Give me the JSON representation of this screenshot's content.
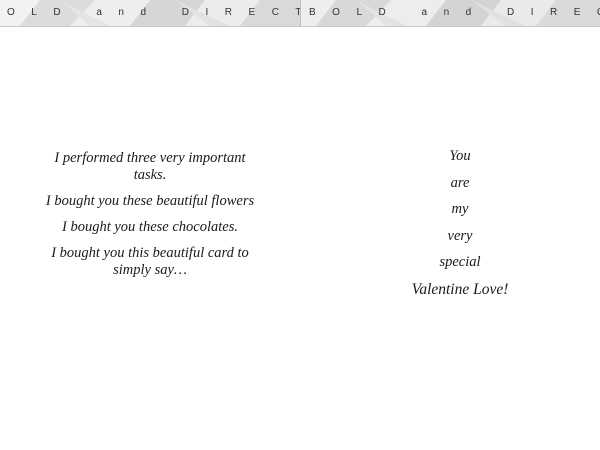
{
  "banner": {
    "left_text": "OLD and DIRECT",
    "right_text": "BOLD and DIREC"
  },
  "left_page": {
    "lines": [
      "I performed three very important tasks.",
      "I bought you these beautiful flowers",
      "I bought you these chocolates.",
      "I bought you this beautiful card to simply say…"
    ]
  },
  "right_page": {
    "lines": [
      "You",
      "are",
      "my",
      "very",
      "special",
      "Valentine Love!"
    ]
  }
}
